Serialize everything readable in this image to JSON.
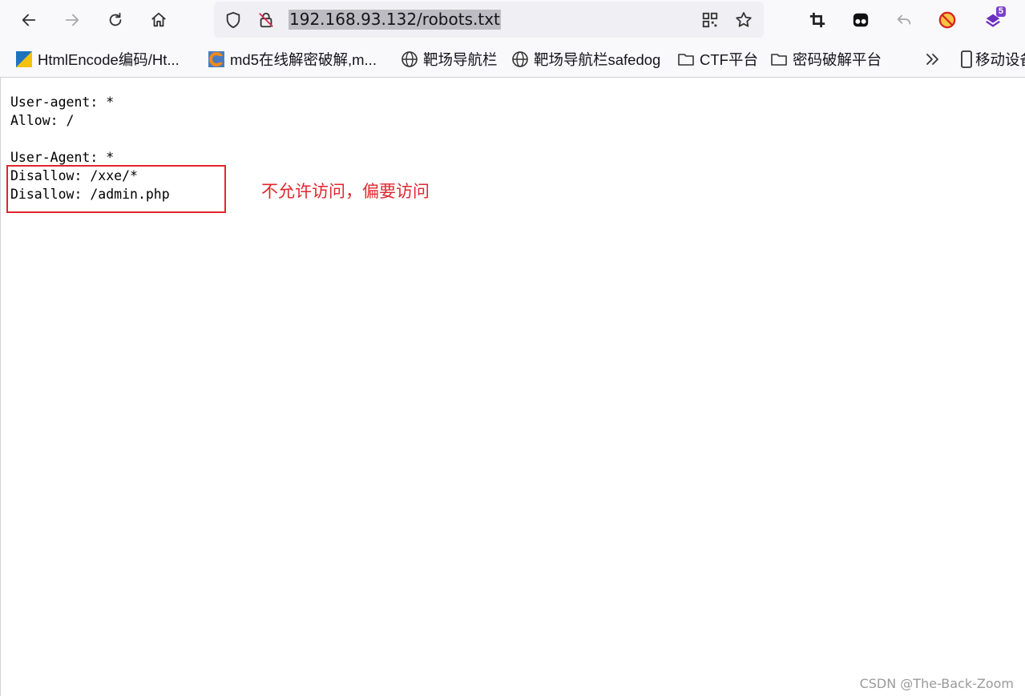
{
  "toolbar": {
    "url": "192.168.93.132/robots.txt",
    "extension_badge": "5"
  },
  "bookmarks": [
    {
      "label": "HtmlEncode编码/Ht...",
      "icon": "htmlencode-favicon"
    },
    {
      "label": "md5在线解密破解,m...",
      "icon": "md5-favicon"
    },
    {
      "label": "靶场导航栏",
      "icon": "globe-icon"
    },
    {
      "label": "靶场导航栏safedog",
      "icon": "globe-icon"
    },
    {
      "label": "CTF平台",
      "icon": "folder-icon"
    },
    {
      "label": "密码破解平台",
      "icon": "folder-icon"
    }
  ],
  "mobile_bookmarks_label": "移动设备",
  "page": {
    "lines": [
      "User-agent: *",
      "Allow: /",
      "",
      "User-Agent: *",
      "Disallow: /xxe/*",
      "Disallow: /admin.php"
    ]
  },
  "annotation": "不允许访问，偏要访问",
  "watermark": "CSDN @The-Back-Zoom",
  "colors": {
    "annotation_red": "#e0262f",
    "toolbar_bg": "#f9f9fb",
    "urlbar_bg": "#f0f0f4"
  }
}
